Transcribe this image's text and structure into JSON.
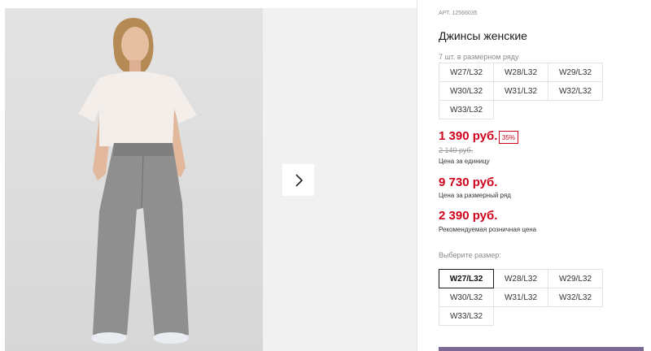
{
  "product": {
    "article": "АРТ. 12566035",
    "title": "Джинсы женские",
    "range_note": "7 шт. в размерном ряду"
  },
  "range_sizes": [
    "W27/L32",
    "W28/L32",
    "W29/L32",
    "W30/L32",
    "W31/L32",
    "W32/L32",
    "W33/L32"
  ],
  "pricing": {
    "unit_price": "1 390 руб.",
    "discount": "35%",
    "old_price": "2 140 руб.",
    "unit_label": "Цена за единицу",
    "range_price": "9 730 руб.",
    "range_label": "Цена за размерный ряд",
    "rrp_price": "2 390 руб.",
    "rrp_label": "Рекомендуемая розничная цена"
  },
  "size_select": {
    "label": "Выберите размер:",
    "options": [
      "W27/L32",
      "W28/L32",
      "W29/L32",
      "W30/L32",
      "W31/L32",
      "W32/L32",
      "W33/L32"
    ],
    "selected": "W27/L32"
  },
  "colors": {
    "price_red": "#d0021b",
    "accent_purple": "#7b6a96"
  },
  "icons": {
    "next": "chevron-right-icon"
  }
}
